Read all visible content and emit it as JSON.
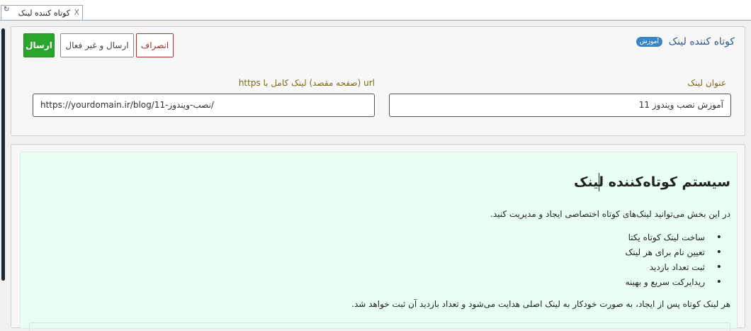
{
  "tab": {
    "refresh_icon": "↻",
    "title": "کوتاه کننده لینک",
    "close_label": "X"
  },
  "header": {
    "title": "کوتاه کننده لینک",
    "badge": "آموزش",
    "buttons": {
      "send": "ارسال",
      "send_inactive": "ارسال و غیر فعال",
      "cancel": "انصراف"
    }
  },
  "form": {
    "title_label": "عنوان لینک",
    "title_value": "آموزش نصب ویندوز 11",
    "url_label": "url (صفحه مقصد) لینک کامل با https",
    "url_value": "https://yourdomain.ir/blog/11-نصب-ویندوز/"
  },
  "info": {
    "heading": "سیستم کوتاه‌کننده لینک",
    "intro": "در این بخش می‌توانید لینک‌های کوتاه اختصاصی ایجاد و مدیریت کنید.",
    "features": [
      "ساخت لینک کوتاه یکتا",
      "تعیین نام برای هر لینک",
      "ثبت تعداد بازدید",
      "ریدایرکت سریع و بهینه"
    ],
    "footer": "هر لینک کوتاه پس از ایجاد، به صورت خودکار به لینک اصلی هدایت می‌شود و تعداد بازدید آن ثبت خواهد شد."
  },
  "colors": {
    "send_button": "#2aa62f",
    "cancel_border": "#b52a2a",
    "title_blue": "#2c5d8f",
    "badge": "#3a86c4",
    "label_text": "#7b6b14",
    "info_background": "#e8fff2"
  }
}
